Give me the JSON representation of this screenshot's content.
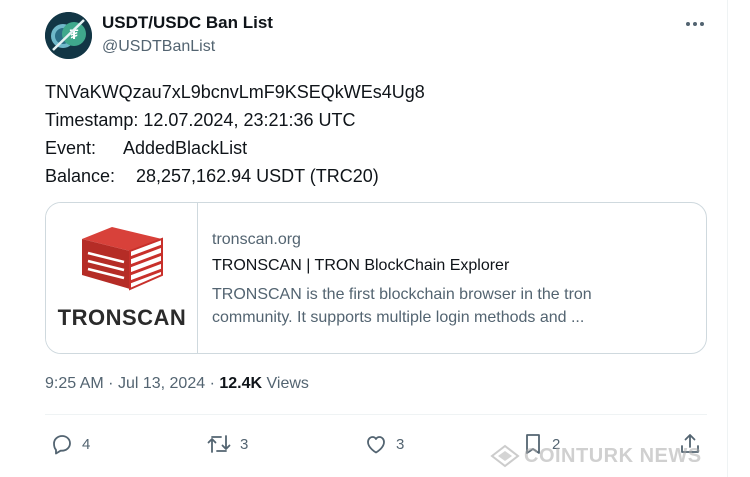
{
  "author": {
    "name": "USDT/USDC Ban List",
    "handle": "@USDTBanList"
  },
  "tweet": {
    "lines": [
      "TNVaKWQzau7xL9bcnvLmF9KSEQkWEs4Ug8",
      "Timestamp: 12.07.2024, 23:21:36 UTC"
    ],
    "event_label": "Event:",
    "event_value": "AddedBlackList",
    "balance_label": "Balance:",
    "balance_value": "28,257,162.94 USDT (TRC20)"
  },
  "card": {
    "brand": "TRONSCAN",
    "domain": "tronscan.org",
    "title": "TRONSCAN | TRON BlockChain Explorer",
    "description_line1": "TRONSCAN is the first blockchain browser in the tron",
    "description_line2": "community. It supports multiple login methods and ..."
  },
  "meta": {
    "time": "9:25 AM",
    "separator": "·",
    "date": "Jul 13, 2024",
    "views_count": "12.4K",
    "views_label": "Views"
  },
  "actions": {
    "replies": "4",
    "retweets": "3",
    "likes": "3",
    "bookmarks": "2"
  },
  "watermark": {
    "text": "COINTURK NEWS"
  },
  "colors": {
    "text_primary": "#0f1419",
    "text_secondary": "#536471",
    "border": "#cfd9de",
    "tronscan_red": "#c8302b"
  },
  "icons": [
    "more-icon",
    "reply-icon",
    "retweet-icon",
    "like-icon",
    "bookmark-icon",
    "share-icon",
    "tronscan-cube-icon"
  ]
}
